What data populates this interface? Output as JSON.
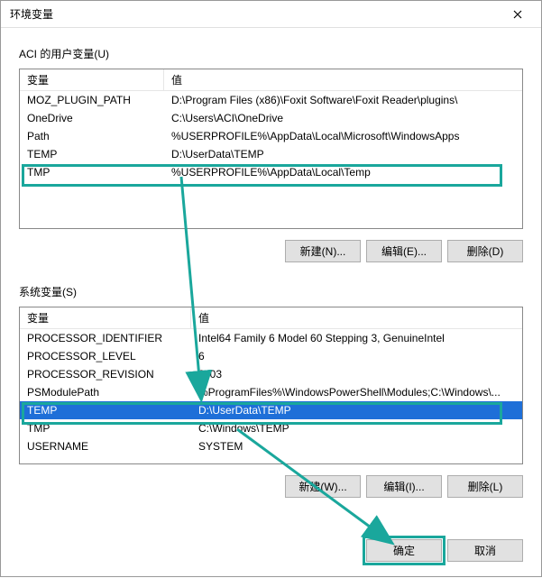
{
  "window": {
    "title": "环境变量"
  },
  "user_section": {
    "label": "ACI 的用户变量(U)",
    "headers": {
      "var": "变量",
      "val": "值"
    },
    "rows": [
      {
        "var": "MOZ_PLUGIN_PATH",
        "val": "D:\\Program Files (x86)\\Foxit Software\\Foxit Reader\\plugins\\"
      },
      {
        "var": "OneDrive",
        "val": "C:\\Users\\ACI\\OneDrive"
      },
      {
        "var": "Path",
        "val": "%USERPROFILE%\\AppData\\Local\\Microsoft\\WindowsApps"
      },
      {
        "var": "TEMP",
        "val": "D:\\UserData\\TEMP"
      },
      {
        "var": "TMP",
        "val": "%USERPROFILE%\\AppData\\Local\\Temp"
      }
    ],
    "buttons": {
      "new": "新建(N)...",
      "edit": "编辑(E)...",
      "delete": "删除(D)"
    }
  },
  "system_section": {
    "label": "系统变量(S)",
    "headers": {
      "var": "变量",
      "val": "值"
    },
    "rows": [
      {
        "var": "PROCESSOR_IDENTIFIER",
        "val": "Intel64 Family 6 Model 60 Stepping 3, GenuineIntel"
      },
      {
        "var": "PROCESSOR_LEVEL",
        "val": "6"
      },
      {
        "var": "PROCESSOR_REVISION",
        "val": "3c03"
      },
      {
        "var": "PSModulePath",
        "val": "%ProgramFiles%\\WindowsPowerShell\\Modules;C:\\Windows\\..."
      },
      {
        "var": "TEMP",
        "val": "D:\\UserData\\TEMP"
      },
      {
        "var": "TMP",
        "val": "C:\\Windows\\TEMP"
      },
      {
        "var": "USERNAME",
        "val": "SYSTEM"
      }
    ],
    "buttons": {
      "new": "新建(W)...",
      "edit": "编辑(I)...",
      "delete": "删除(L)"
    }
  },
  "dialog_buttons": {
    "ok": "确定",
    "cancel": "取消"
  }
}
